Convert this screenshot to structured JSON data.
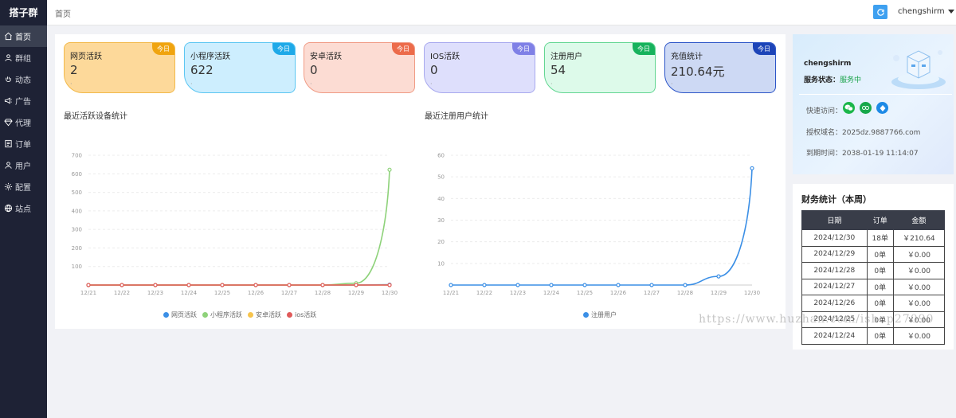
{
  "sidebar": {
    "logo": "搭子群",
    "items": [
      {
        "label": "首页",
        "icon": "home-icon"
      },
      {
        "label": "群组",
        "icon": "group-icon"
      },
      {
        "label": "动态",
        "icon": "hand-icon"
      },
      {
        "label": "广告",
        "icon": "megaphone-icon"
      },
      {
        "label": "代理",
        "icon": "diamond-icon"
      },
      {
        "label": "订单",
        "icon": "list-icon"
      },
      {
        "label": "用户",
        "icon": "user-icon"
      },
      {
        "label": "配置",
        "icon": "gear-icon"
      },
      {
        "label": "站点",
        "icon": "globe-icon"
      }
    ]
  },
  "header": {
    "breadcrumb": "首页",
    "username": "chengshirm"
  },
  "stats": [
    {
      "title": "网页活跃",
      "value": "2",
      "tag": "今日",
      "bg": "#fdd99a",
      "border": "#f2b94a",
      "tagColor": "#f0a40f"
    },
    {
      "title": "小程序活跃",
      "value": "622",
      "tag": "今日",
      "bg": "#cdeefe",
      "border": "#5cc6f2",
      "tagColor": "#1ea9e8"
    },
    {
      "title": "安卓活跃",
      "value": "0",
      "tag": "今日",
      "bg": "#fcdcd3",
      "border": "#f09b85",
      "tagColor": "#ec6b4a"
    },
    {
      "title": "IOS活跃",
      "value": "0",
      "tag": "今日",
      "bg": "#dedffc",
      "border": "#a8a9ee",
      "tagColor": "#7f80e6"
    },
    {
      "title": "注册用户",
      "value": "54",
      "tag": "今日",
      "bg": "#ddfaea",
      "border": "#63d692",
      "tagColor": "#17b25d"
    },
    {
      "title": "充值统计",
      "value": "210.64元",
      "tag": "今日",
      "bg": "#cdd9f4",
      "border": "#2d56c8",
      "tagColor": "#1c44b8"
    }
  ],
  "charts": {
    "left_title": "最近活跃设备统计",
    "right_title": "最近注册用户统计"
  },
  "chart_data": [
    {
      "type": "line",
      "title": "最近活跃设备统计",
      "x": [
        "12/21",
        "12/22",
        "12/23",
        "12/24",
        "12/25",
        "12/26",
        "12/27",
        "12/28",
        "12/29",
        "12/30"
      ],
      "ylim": [
        0,
        700
      ],
      "yticks": [
        100,
        200,
        300,
        400,
        500,
        600,
        700
      ],
      "grid": true,
      "legend": "bottom",
      "series": [
        {
          "name": "网页活跃",
          "color": "#3b8fe6",
          "values": [
            0,
            0,
            0,
            0,
            0,
            0,
            0,
            0,
            0,
            2
          ]
        },
        {
          "name": "小程序活跃",
          "color": "#8ed27a",
          "values": [
            0,
            0,
            0,
            0,
            0,
            0,
            0,
            0,
            10,
            622
          ]
        },
        {
          "name": "安卓活跃",
          "color": "#f7c44d",
          "values": [
            0,
            0,
            0,
            0,
            0,
            0,
            0,
            0,
            0,
            0
          ]
        },
        {
          "name": "ios活跃",
          "color": "#e05a5a",
          "values": [
            0,
            0,
            0,
            0,
            0,
            0,
            0,
            0,
            0,
            0
          ]
        }
      ]
    },
    {
      "type": "line",
      "title": "最近注册用户统计",
      "x": [
        "12/21",
        "12/22",
        "12/23",
        "12/24",
        "12/25",
        "12/26",
        "12/27",
        "12/28",
        "12/29",
        "12/30"
      ],
      "ylim": [
        0,
        60
      ],
      "yticks": [
        10,
        20,
        30,
        40,
        50,
        60
      ],
      "grid": true,
      "legend": "bottom",
      "series": [
        {
          "name": "注册用户",
          "color": "#3b8fe6",
          "values": [
            0,
            0,
            0,
            0,
            0,
            0,
            0,
            0,
            4,
            54
          ]
        }
      ]
    }
  ],
  "info": {
    "username": "chengshirm",
    "status_label": "服务状态：",
    "status_value": "服务中",
    "quick_label": "快速访问：",
    "domain_label": "授权域名：",
    "domain_value": "2025dz.9887766.com",
    "expire_label": "到期时间：",
    "expire_value": "2038-01-19 11:14:07"
  },
  "finance": {
    "title": "财务统计（本周）",
    "columns": [
      "日期",
      "订单",
      "金额"
    ],
    "rows": [
      [
        "2024/12/30",
        "18单",
        "￥210.64"
      ],
      [
        "2024/12/29",
        "0单",
        "￥0.00"
      ],
      [
        "2024/12/28",
        "0单",
        "￥0.00"
      ],
      [
        "2024/12/27",
        "0单",
        "￥0.00"
      ],
      [
        "2024/12/26",
        "0单",
        "￥0.00"
      ],
      [
        "2024/12/25",
        "0单",
        "￥0.00"
      ],
      [
        "2024/12/24",
        "0单",
        "￥0.00"
      ]
    ]
  },
  "watermark": "https://www.huzhan.com/ishop27090"
}
